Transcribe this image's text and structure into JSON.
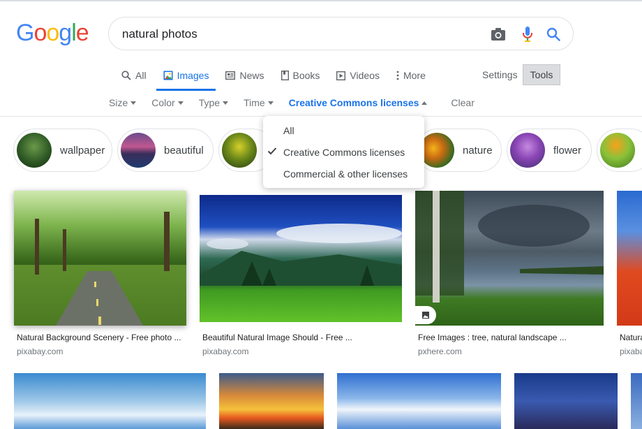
{
  "logo": {
    "letters": [
      "G",
      "o",
      "o",
      "g",
      "l",
      "e"
    ],
    "colors": [
      "#4285f4",
      "#ea4335",
      "#fbbc05",
      "#4285f4",
      "#34a853",
      "#ea4335"
    ]
  },
  "search": {
    "query": "natural photos",
    "camera_icon": "camera-icon",
    "mic_icon": "microphone-icon",
    "search_icon": "search-icon"
  },
  "tabs": [
    {
      "label": "All",
      "icon": "search-icon"
    },
    {
      "label": "Images",
      "icon": "image-icon",
      "active": true
    },
    {
      "label": "News",
      "icon": "news-icon"
    },
    {
      "label": "Books",
      "icon": "book-icon"
    },
    {
      "label": "Videos",
      "icon": "play-icon"
    },
    {
      "label": "More",
      "icon": "more-vertical-icon"
    }
  ],
  "settings_label": "Settings",
  "tools_label": "Tools",
  "tools_row": {
    "size": "Size",
    "color": "Color",
    "type": "Type",
    "time": "Time",
    "license": "Creative Commons licenses",
    "clear": "Clear"
  },
  "chips": [
    {
      "label": "wallpaper"
    },
    {
      "label": "beautiful"
    },
    {
      "label": ""
    },
    {
      "label": "nature"
    },
    {
      "label": "flower"
    },
    {
      "label": ""
    }
  ],
  "dropdown": {
    "items": [
      {
        "label": "All",
        "checked": false
      },
      {
        "label": "Creative Commons licenses",
        "checked": true
      },
      {
        "label": "Commercial & other licenses",
        "checked": false
      }
    ]
  },
  "results": [
    {
      "caption": "Natural Background Scenery - Free photo ...",
      "source": "pixabay.com"
    },
    {
      "caption": "Beautiful Natural Image Should - Free ...",
      "source": "pixabay.com"
    },
    {
      "caption": "Free Images : tree, natural landscape ...",
      "source": "pxhere.com"
    },
    {
      "caption": "Natura",
      "source": "pixaba"
    }
  ],
  "accent": "#1a73e8"
}
